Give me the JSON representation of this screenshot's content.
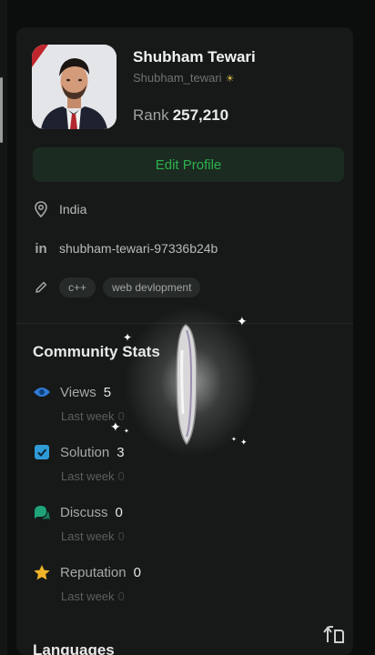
{
  "profile": {
    "name": "Shubham Tewari",
    "handle": "Shubham_tewari",
    "rank_label": "Rank",
    "rank_value": "257,210",
    "edit_label": "Edit Profile"
  },
  "info": {
    "location": "India",
    "linkedin": "shubham-tewari-97336b24b",
    "skills": [
      "c++",
      "web devlopment"
    ]
  },
  "community": {
    "title": "Community Stats",
    "stats": [
      {
        "label": "Views",
        "value": "5",
        "sub": "Last week",
        "sub_value": "0",
        "icon": "eye-icon",
        "color": "#2f7bd6"
      },
      {
        "label": "Solution",
        "value": "3",
        "sub": "Last week",
        "sub_value": "0",
        "icon": "checkbox-icon",
        "color": "#2f9bd6"
      },
      {
        "label": "Discuss",
        "value": "0",
        "sub": "Last week",
        "sub_value": "0",
        "icon": "discuss-icon",
        "color": "#1fa37a"
      },
      {
        "label": "Reputation",
        "value": "0",
        "sub": "Last week",
        "sub_value": "0",
        "icon": "star-icon",
        "color": "#f0b429"
      }
    ]
  },
  "languages": {
    "title": "Languages"
  },
  "accent": {
    "green": "#2bb24e"
  }
}
